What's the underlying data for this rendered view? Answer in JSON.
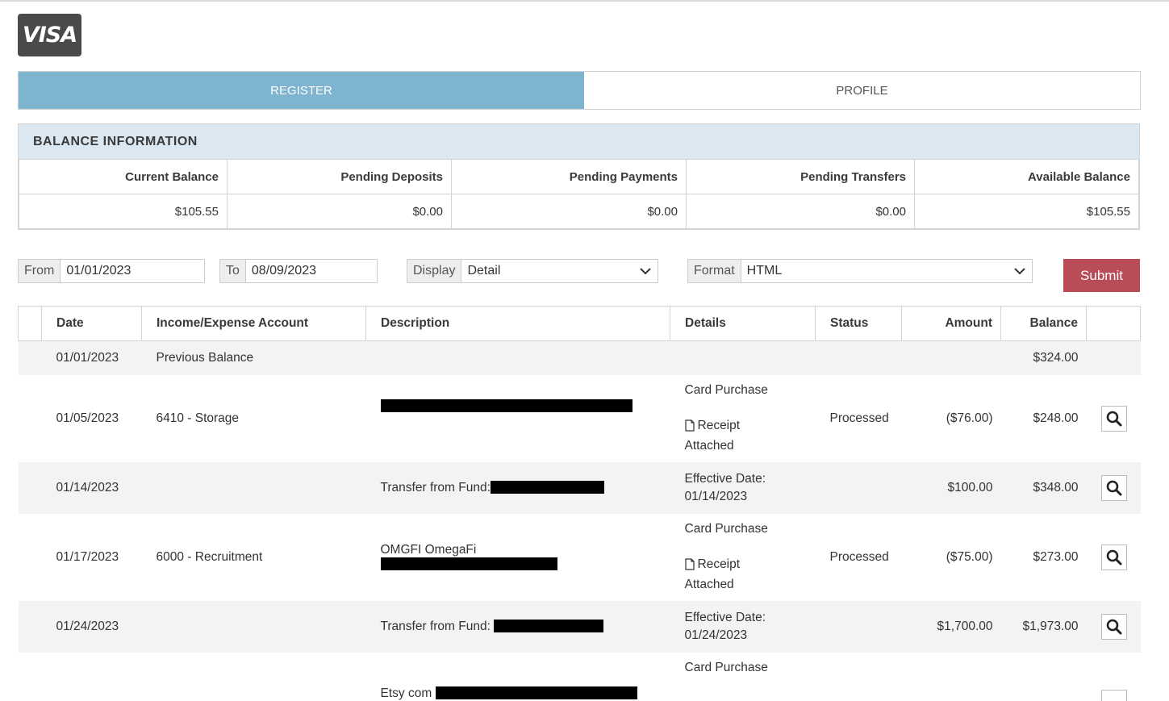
{
  "logo": {
    "text": "VISA"
  },
  "tabs": [
    {
      "label": "REGISTER",
      "active": true
    },
    {
      "label": "PROFILE",
      "active": false
    }
  ],
  "balance": {
    "heading": "BALANCE INFORMATION",
    "headers": [
      "Current Balance",
      "Pending Deposits",
      "Pending Payments",
      "Pending Transfers",
      "Available Balance"
    ],
    "values": [
      "$105.55",
      "$0.00",
      "$0.00",
      "$0.00",
      "$105.55"
    ]
  },
  "filters": {
    "from": {
      "label": "From",
      "value": "01/01/2023"
    },
    "to": {
      "label": "To",
      "value": "08/09/2023"
    },
    "display": {
      "label": "Display",
      "value": "Detail"
    },
    "format": {
      "label": "Format",
      "value": "HTML"
    },
    "submit_label": "Submit"
  },
  "register": {
    "headers": {
      "date": "Date",
      "account": "Income/Expense Account",
      "description": "Description",
      "details": "Details",
      "status": "Status",
      "amount": "Amount",
      "balance": "Balance"
    },
    "rows": [
      {
        "date": "01/01/2023",
        "account": "Previous Balance",
        "description": "",
        "details_line1": "",
        "details_line2": "",
        "status": "",
        "amount": "",
        "balance": "$324.00"
      },
      {
        "date": "01/05/2023",
        "account": "6410 - Storage",
        "description": "",
        "details_line1": "Card Purchase",
        "details_receipt": "Receipt",
        "details_line2": "Attached",
        "status": "Processed",
        "amount": "($76.00)",
        "balance": "$248.00"
      },
      {
        "date": "01/14/2023",
        "account": "",
        "description": "Transfer from Fund:",
        "details_line1": "Effective Date:",
        "details_line2": "01/14/2023",
        "status": "",
        "amount": "$100.00",
        "balance": "$348.00"
      },
      {
        "date": "01/17/2023",
        "account": "6000 - Recruitment",
        "description": "OMGFI OmegaFi",
        "details_line1": "Card Purchase",
        "details_receipt": "Receipt",
        "details_line2": "Attached",
        "status": "Processed",
        "amount": "($75.00)",
        "balance": "$273.00"
      },
      {
        "date": "01/24/2023",
        "account": "",
        "description": "Transfer from Fund:",
        "details_line1": "Effective Date:",
        "details_line2": "01/24/2023",
        "status": "",
        "amount": "$1,700.00",
        "balance": "$1,973.00"
      },
      {
        "date": "",
        "account": "",
        "description": "Etsy com",
        "details_line1": "Card Purchase",
        "details_line2": "",
        "status": "",
        "amount": "",
        "balance": ""
      }
    ]
  },
  "colors": {
    "tab_active": "#7eb4cf",
    "balance_header": "#dbe7f1",
    "submit": "#b84c57",
    "negative": "#a6424e"
  },
  "icons": [
    "search-icon",
    "chevron-down-icon",
    "document-icon"
  ]
}
